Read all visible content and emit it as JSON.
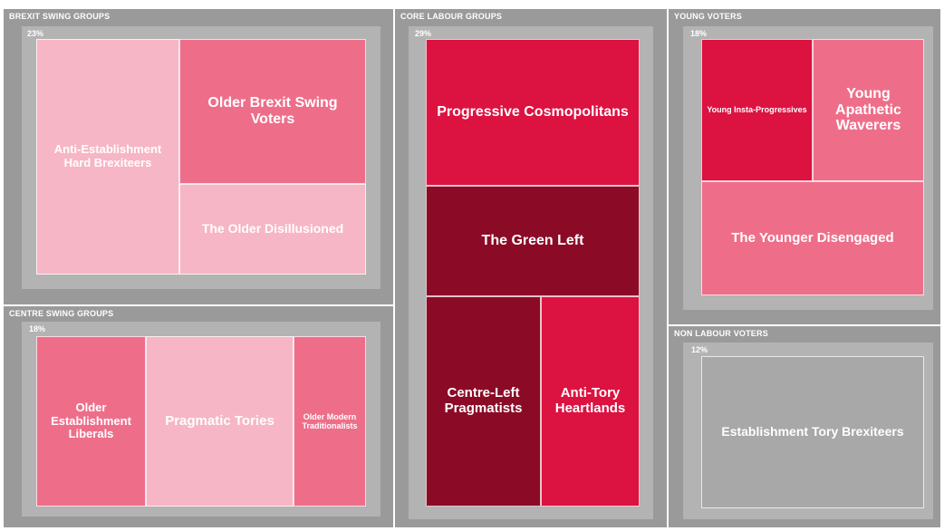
{
  "chart_data": {
    "type": "treemap",
    "groups": [
      {
        "id": "brexit",
        "title": "BREXIT SWING GROUPS",
        "pct_label": "23%",
        "segments": [
          {
            "label": "Anti-Establishment Hard Brexiteers",
            "color": "#f7b6c5"
          },
          {
            "label": "Older Brexit Swing Voters",
            "color": "#ee6e8a"
          },
          {
            "label": "The Older Disillusioned",
            "color": "#f7b6c5"
          }
        ]
      },
      {
        "id": "core",
        "title": "CORE LABOUR GROUPS",
        "pct_label": "29%",
        "segments": [
          {
            "label": "Progressive Cosmopolitans",
            "color": "#dc1240"
          },
          {
            "label": "The Green Left",
            "color": "#8b0b27"
          },
          {
            "label": "Centre-Left Pragmatists",
            "color": "#8b0b27"
          },
          {
            "label": "Anti-Tory Heartlands",
            "color": "#dc1240"
          }
        ]
      },
      {
        "id": "young",
        "title": "YOUNG VOTERS",
        "pct_label": "18%",
        "segments": [
          {
            "label": "Young Insta-Progressives",
            "color": "#dc1240"
          },
          {
            "label": "Young Apathetic Waverers",
            "color": "#ee6e8a"
          },
          {
            "label": "The Younger Disengaged",
            "color": "#ee6e8a"
          }
        ]
      },
      {
        "id": "centre",
        "title": "CENTRE SWING GROUPS",
        "pct_label": "18%",
        "segments": [
          {
            "label": "Older Establishment Liberals",
            "color": "#ee6e8a"
          },
          {
            "label": "Pragmatic Tories",
            "color": "#f7b6c5"
          },
          {
            "label": "Older Modern Traditionalists",
            "color": "#ee6e8a"
          }
        ]
      },
      {
        "id": "non",
        "title": "NON LABOUR VOTERS",
        "pct_label": "12%",
        "segments": [
          {
            "label": "Establishment Tory Brexiteers",
            "color": "#a8a8a8"
          }
        ]
      }
    ]
  }
}
